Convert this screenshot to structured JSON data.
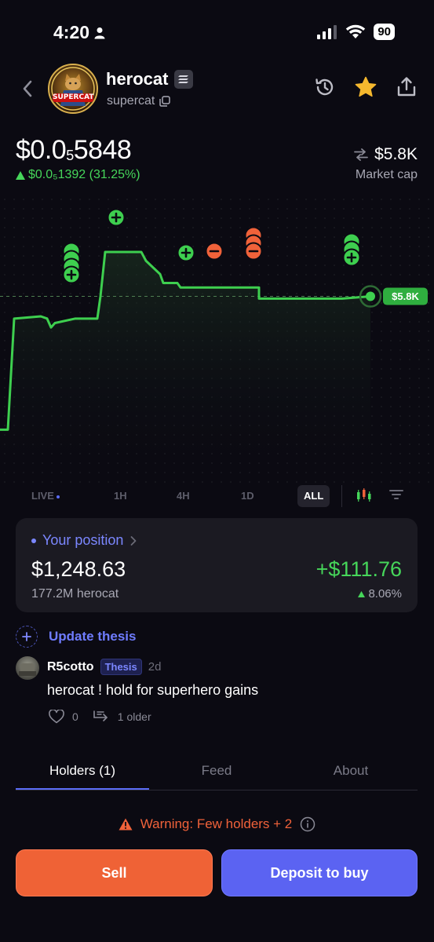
{
  "status": {
    "time": "4:20",
    "battery": "90"
  },
  "header": {
    "token_name": "herocat",
    "token_symbol": "supercat",
    "avatar_label": "SUPERCAT",
    "icons": [
      "back-chevron-icon",
      "history-icon",
      "star-icon",
      "share-icon"
    ]
  },
  "price": {
    "prefix": "$0.0",
    "subscript_zeros": "5",
    "digits": "5848",
    "change_text": "$0.0₅1392 (31.25%)",
    "change_direction": "up"
  },
  "market_cap": {
    "value": "$5.8K",
    "label": "Market cap"
  },
  "chart_data": {
    "type": "line",
    "current_label": "$5.8K",
    "line_color": "#3ecf4f",
    "buy_color": "#3ecf4f",
    "sell_color": "#f0623a",
    "y_relative": [
      0.02,
      0.52,
      0.53,
      0.52,
      0.48,
      0.5,
      0.52,
      0.52,
      0.62,
      0.82,
      0.82,
      0.78,
      0.72,
      0.68,
      0.68,
      0.66,
      0.66,
      0.66,
      0.61,
      0.61,
      0.62
    ],
    "trade_markers": [
      {
        "kind": "buy",
        "count": 4
      },
      {
        "kind": "buy",
        "count": 1
      },
      {
        "kind": "buy",
        "count": 1
      },
      {
        "kind": "sell",
        "count": 1
      },
      {
        "kind": "sell",
        "count": 3
      },
      {
        "kind": "buy",
        "count": 3
      }
    ]
  },
  "ranges": {
    "items": [
      "LIVE",
      "1H",
      "4H",
      "1D",
      "ALL"
    ],
    "active": "ALL",
    "icons": [
      "candlestick-icon",
      "filter-icon"
    ]
  },
  "position": {
    "title": "Your position",
    "value": "$1,248.63",
    "amount": "177.2M herocat",
    "pnl": "+$111.76",
    "pnl_pct": "8.06%"
  },
  "thesis": {
    "label": "Update thesis"
  },
  "comment": {
    "user": "R5cotto",
    "badge": "Thesis",
    "time": "2d",
    "text": "herocat ! hold for superhero gains",
    "likes": "0",
    "older": "1 older"
  },
  "tabs": [
    "Holders (1)",
    "Feed",
    "About"
  ],
  "warning": "Warning: Few holders + 2",
  "actions": {
    "sell": "Sell",
    "buy": "Deposit to buy"
  }
}
